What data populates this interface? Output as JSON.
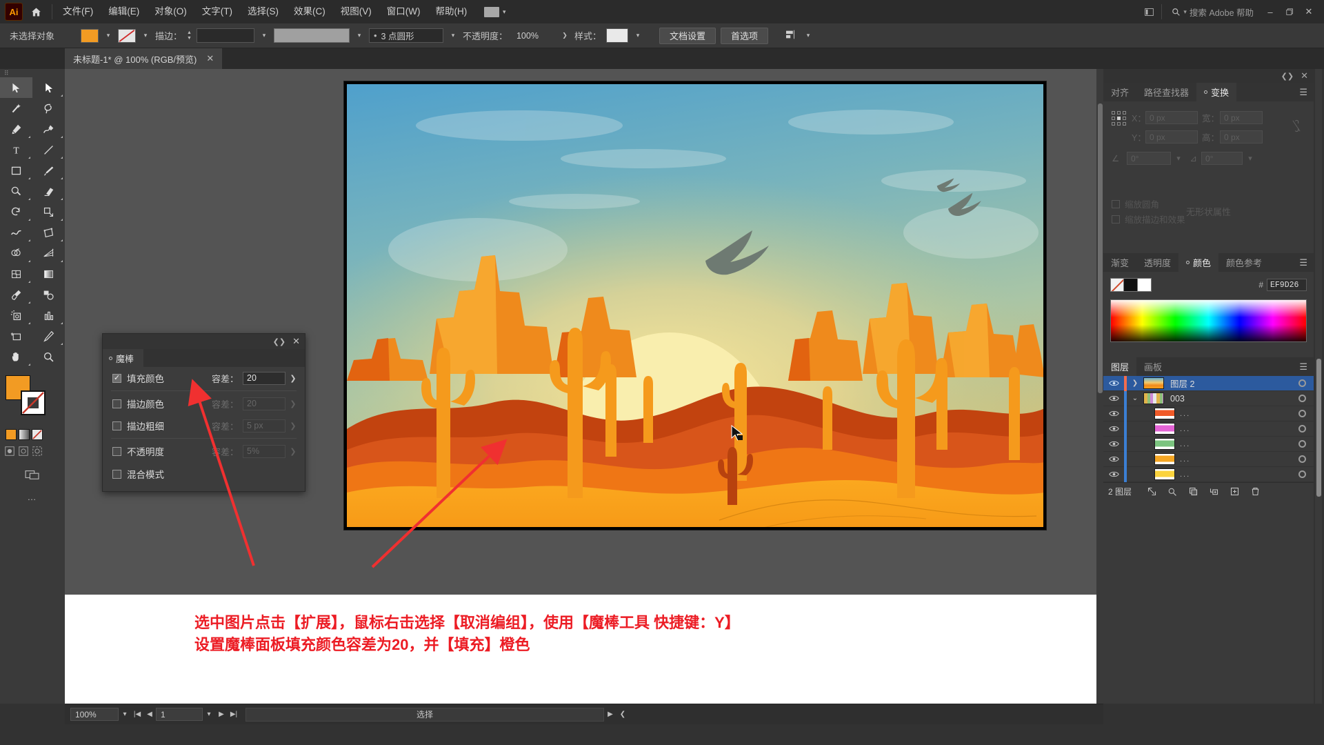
{
  "app": {
    "name": "Adobe Illustrator",
    "logo_text": "Ai"
  },
  "menubar": {
    "items": [
      "文件(F)",
      "编辑(E)",
      "对象(O)",
      "文字(T)",
      "选择(S)",
      "效果(C)",
      "视图(V)",
      "窗口(W)",
      "帮助(H)"
    ],
    "search_placeholder": "搜索 Adobe 帮助",
    "home_icon": "home-icon",
    "workspace_icon": "workspace-switcher-icon"
  },
  "controlbar": {
    "selection_status": "未选择对象",
    "fill_color": "#F29B23",
    "stroke_label": "描边：",
    "stroke_weight": "",
    "stroke_profile": "3 点圆形",
    "opacity_label": "不透明度：",
    "opacity_value": "100%",
    "style_label": "样式：",
    "doc_setup": "文档设置",
    "preferences": "首选项"
  },
  "tab": {
    "title": "未标题-1* @ 100% (RGB/预览)",
    "close_icon": "close-icon"
  },
  "toolbar": {
    "tools": [
      {
        "name": "selection-tool",
        "glyph": "arrow",
        "active": true
      },
      {
        "name": "direct-selection-tool",
        "glyph": "arrow-white"
      },
      {
        "name": "magic-wand-tool",
        "glyph": "wand"
      },
      {
        "name": "lasso-tool",
        "glyph": "lasso"
      },
      {
        "name": "pen-tool",
        "glyph": "pen"
      },
      {
        "name": "curvature-tool",
        "glyph": "curvature"
      },
      {
        "name": "type-tool",
        "glyph": "T"
      },
      {
        "name": "line-segment-tool",
        "glyph": "line"
      },
      {
        "name": "rectangle-tool",
        "glyph": "rect"
      },
      {
        "name": "paintbrush-tool",
        "glyph": "brush"
      },
      {
        "name": "shaper-tool",
        "glyph": "shaper"
      },
      {
        "name": "eraser-tool",
        "glyph": "eraser"
      },
      {
        "name": "rotate-tool",
        "glyph": "rotate"
      },
      {
        "name": "scale-tool",
        "glyph": "scale"
      },
      {
        "name": "width-tool",
        "glyph": "width"
      },
      {
        "name": "free-transform-tool",
        "glyph": "freetransform"
      },
      {
        "name": "shape-builder-tool",
        "glyph": "shapebuilder"
      },
      {
        "name": "perspective-grid-tool",
        "glyph": "perspective"
      },
      {
        "name": "mesh-tool",
        "glyph": "mesh"
      },
      {
        "name": "gradient-tool",
        "glyph": "gradient"
      },
      {
        "name": "eyedropper-tool",
        "glyph": "eyedropper"
      },
      {
        "name": "blend-tool",
        "glyph": "blend"
      },
      {
        "name": "symbol-sprayer-tool",
        "glyph": "symbolsprayer"
      },
      {
        "name": "column-graph-tool",
        "glyph": "graph"
      },
      {
        "name": "artboard-tool",
        "glyph": "artboard"
      },
      {
        "name": "slice-tool",
        "glyph": "slice"
      },
      {
        "name": "hand-tool",
        "glyph": "hand"
      },
      {
        "name": "zoom-tool",
        "glyph": "zoom"
      }
    ],
    "fill_color": "#F29B23",
    "stroke_color": "#FFFFFF",
    "more_tools": "…"
  },
  "wand_panel": {
    "title": "魔棒",
    "collapse_icon": "collapse-icon",
    "close_icon": "close-icon",
    "rows": [
      {
        "label": "填充颜色",
        "checked": true,
        "tol_label": "容差：",
        "tol_value": "20",
        "enabled": true
      },
      {
        "label": "描边颜色",
        "checked": false,
        "tol_label": "容差：",
        "tol_value": "20",
        "enabled": false
      },
      {
        "label": "描边粗细",
        "checked": false,
        "tol_label": "容差：",
        "tol_value": "5 px",
        "enabled": false
      },
      {
        "label": "不透明度",
        "checked": false,
        "tol_label": "容差：",
        "tol_value": "5%",
        "enabled": false
      },
      {
        "label": "混合模式",
        "checked": false,
        "tol_label": "",
        "tol_value": "",
        "enabled": false
      }
    ]
  },
  "transform_panel": {
    "tabs": [
      "对齐",
      "路径查找器",
      "变换"
    ],
    "active_tab": "变换",
    "x_label": "X：",
    "x_value": "0 px",
    "y_label": "Y：",
    "y_value": "0 px",
    "w_label": "宽：",
    "w_value": "0 px",
    "h_label": "高：",
    "h_value": "0 px",
    "angle_value": "0°",
    "shear_value": "0°",
    "no_properties": "无形状属性",
    "chk_scale_corners": "缩放圆角",
    "chk_scale_strokes": "缩放描边和效果",
    "link_icon": "link-broken-icon",
    "anchor_icon": "reference-point-icon"
  },
  "color_panel": {
    "tabs": [
      "渐变",
      "透明度",
      "颜色",
      "颜色参考"
    ],
    "active_tab": "颜色",
    "hex_prefix": "#",
    "hex_value": "EF9D26",
    "none_swatch": "none-swatch-icon",
    "black_swatch": "#000000",
    "white_swatch": "#FFFFFF"
  },
  "layers_panel": {
    "tabs": [
      "图层",
      "画板"
    ],
    "active_tab": "图层",
    "rows": [
      {
        "name": "图层 2",
        "thumb": "artwork-thumb",
        "selected": true,
        "expanded": false,
        "indent": 0,
        "eye": "eye-icon"
      },
      {
        "name": "003",
        "thumb": "group-thumb",
        "selected": false,
        "expanded": true,
        "indent": 1,
        "eye": "eye-icon"
      },
      {
        "name": "...",
        "thumb": "path-thumb-orange",
        "selected": false,
        "indent": 2,
        "eye": "eye-icon"
      },
      {
        "name": "...",
        "thumb": "path-thumb-magenta",
        "selected": false,
        "indent": 2,
        "eye": "eye-icon"
      },
      {
        "name": "...",
        "thumb": "path-thumb-green",
        "selected": false,
        "indent": 2,
        "eye": "eye-icon"
      },
      {
        "name": "...",
        "thumb": "path-thumb-amber",
        "selected": false,
        "indent": 2,
        "eye": "eye-icon"
      },
      {
        "name": "...",
        "thumb": "path-thumb-yellow",
        "selected": false,
        "indent": 2,
        "eye": "eye-icon"
      }
    ],
    "footer_count": "2 图层",
    "footer_icons": [
      "locate-object-icon",
      "search-icon",
      "make-clipping-mask-icon",
      "create-sublayer-icon",
      "create-new-layer-icon",
      "delete-layer-icon"
    ]
  },
  "annotation": {
    "line1": "选中图片点击【扩展】，鼠标右击选择【取消编组】，使用【魔棒工具 快捷键：Y】",
    "line2": "设置魔棒面板填充颜色容差为20，并【填充】橙色",
    "color": "#EC1C24"
  },
  "statusbar": {
    "zoom": "100%",
    "page": "1",
    "tool_status": "选择"
  },
  "artwork": {
    "title": "desert-sunset-illustration",
    "sky_top": "#5aa9cf",
    "sky_mid": "#9dc2b6",
    "sun": "#f8ecab",
    "sand": "#f9a01b",
    "mesa_dark": "#c2430f",
    "mesa_mid": "#ef7615",
    "cactus": "#f59a1c"
  }
}
